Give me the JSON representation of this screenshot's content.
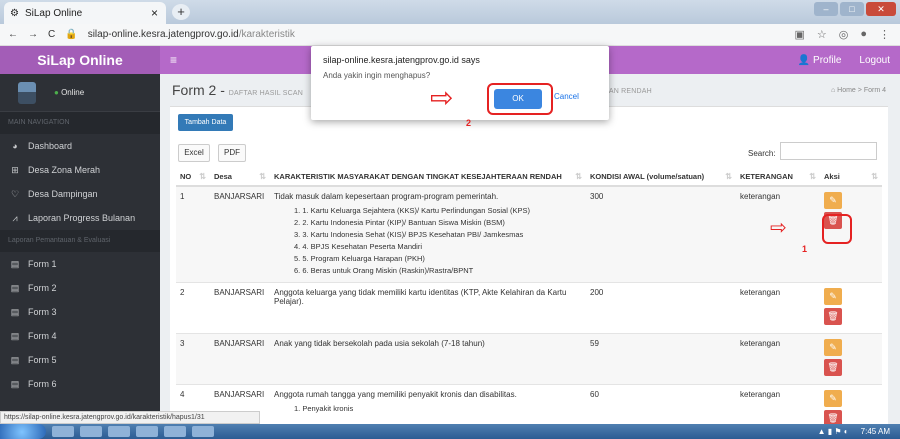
{
  "browser": {
    "tab_title": "SiLap Online",
    "tab_close": "×",
    "new_tab": "+",
    "url_host": "silap-online.kesra.jatengprov.go.id",
    "url_path": "/karakteristik"
  },
  "app": {
    "logo": "SiLap Online",
    "menu_icon": "≡",
    "profile": "Profile",
    "logout": "Logout"
  },
  "sidebar": {
    "status": "Online",
    "main_nav": "MAIN NAVIGATION",
    "items": [
      {
        "label": "Dashboard",
        "icon": "dashboard-icon"
      },
      {
        "label": "Desa Zona Merah",
        "icon": "plus-square-icon"
      },
      {
        "label": "Desa Dampingan",
        "icon": "heart-icon"
      },
      {
        "label": "Laporan Progress Bulanan",
        "icon": "line-chart-icon"
      }
    ],
    "section2": "Laporan Pemantauan & Evaluasi",
    "forms": [
      "Form 1",
      "Form 2",
      "Form 3",
      "Form 4",
      "Form 5",
      "Form 6"
    ]
  },
  "page": {
    "title": "Form 2 -",
    "subtitle": "DAFTAR HASIL SCAN",
    "subtitle_tail": "AAN RENDAH",
    "breadcrumb_home": "Home",
    "breadcrumb_current": "Form 4"
  },
  "toolbar": {
    "add": "Tambah Data",
    "excel": "Excel",
    "pdf": "PDF",
    "search_label": "Search:"
  },
  "table": {
    "headers": [
      "NO",
      "Desa",
      "KARAKTERISTIK MASYARAKAT DENGAN TINGKAT KESEJAHTERAAN RENDAH",
      "KONDISI AWAL (volume/satuan)",
      "KETERANGAN",
      "Aksi"
    ],
    "rows": [
      {
        "no": "1",
        "desa": "BANJARSARI",
        "text": "Tidak masuk dalam kepesertaan program-program pemerintah.",
        "list": [
          "1. 1. Kartu Keluarga Sejahtera (KKS)/ Kartu Perlindungan Sosial (KPS)",
          "2. 2. Kartu Indonesia Pintar (KIP)/ Bantuan Siswa Miskin (BSM)",
          "3. 3. Kartu Indonesia Sehat (KIS)/ BPJS Kesehatan PBI/ Jamkesmas",
          "4. 4. BPJS Kesehatan Peserta Mandiri",
          "5. 5. Program Keluarga Harapan (PKH)",
          "6. 6. Beras untuk Orang Miskin (Raskin)/Rastra/BPNT"
        ],
        "kondisi": "300",
        "ket": "keterangan"
      },
      {
        "no": "2",
        "desa": "BANJARSARI",
        "text": "Anggota keluarga yang tidak memiliki kartu identitas (KTP, Akte Kelahiran da Kartu Pelajar).",
        "list": [],
        "kondisi": "200",
        "ket": "keterangan"
      },
      {
        "no": "3",
        "desa": "BANJARSARI",
        "text": "Anak yang tidak bersekolah pada usia sekolah (7-18 tahun)",
        "list": [],
        "kondisi": "59",
        "ket": "keterangan"
      },
      {
        "no": "4",
        "desa": "BANJARSARI",
        "text": "Anggota rumah tangga yang memiliki penyakit kronis dan disabilitas.",
        "list": [
          "1. Penyakit kronis"
        ],
        "kondisi": "60",
        "ket": "keterangan"
      }
    ]
  },
  "dialog": {
    "title": "silap-online.kesra.jatengprov.go.id says",
    "message": "Anda yakin ingin menghapus?",
    "ok": "OK",
    "cancel": "Cancel"
  },
  "annotations": {
    "step1": "1",
    "step2": "2"
  },
  "status_url": "https://silap-online.kesra.jatengprov.go.id/karakteristik/hapus1/31",
  "clock": "7:45 AM",
  "colors": {
    "header": "#b569c9",
    "sidebar": "#2d3036",
    "primary": "#337ab7",
    "danger": "#d9534f",
    "warning": "#f0ad4e",
    "annotation": "#e52222"
  }
}
